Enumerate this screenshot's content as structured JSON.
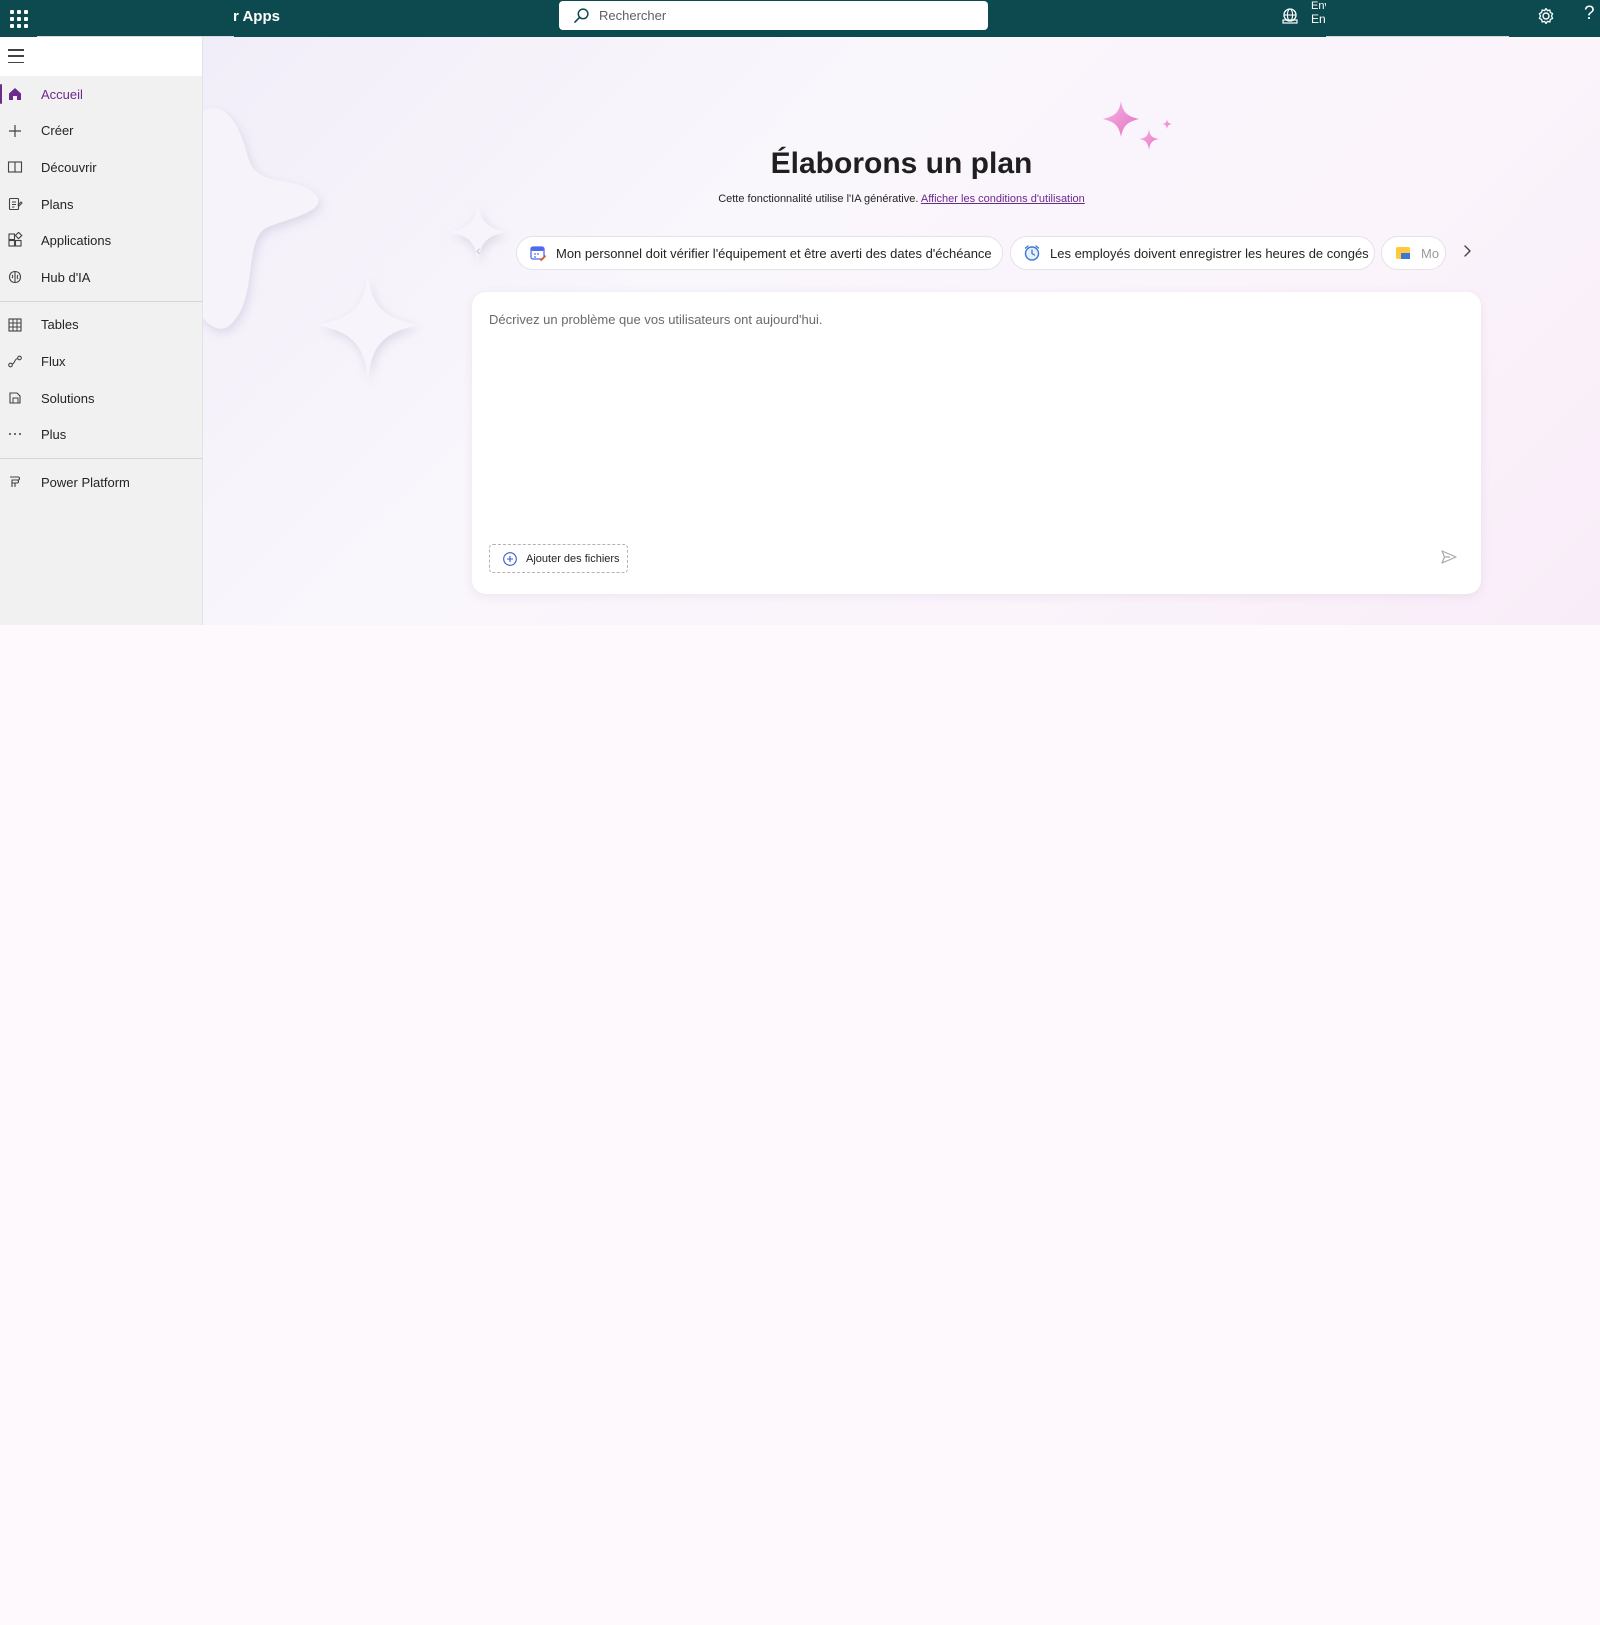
{
  "topbar": {
    "app_name": "r Apps",
    "search_placeholder": "Rechercher",
    "environment_line1": "Env",
    "environment_line2": "En",
    "help_label": "?"
  },
  "sidebar": {
    "items": [
      {
        "label": "Accueil",
        "icon": "home-icon",
        "active": true
      },
      {
        "label": "Créer",
        "icon": "plus-icon"
      },
      {
        "label": "Découvrir",
        "icon": "book-icon"
      },
      {
        "label": "Plans",
        "icon": "plans-icon"
      },
      {
        "label": "Applications",
        "icon": "apps-icon"
      },
      {
        "label": "Hub d'IA",
        "icon": "brain-icon"
      },
      {
        "label": "Tables",
        "icon": "table-icon"
      },
      {
        "label": "Flux",
        "icon": "flow-icon"
      },
      {
        "label": "Solutions",
        "icon": "solutions-icon"
      },
      {
        "label": "Plus",
        "icon": "more-icon"
      },
      {
        "label": "Power Platform",
        "icon": "power-platform-icon"
      }
    ]
  },
  "main": {
    "title": "Élaborons un plan",
    "subtitle": "Cette fonctionnalité utilise l'IA générative.",
    "terms_link": "Afficher les conditions d'utilisation",
    "suggestions": [
      {
        "label": "Mon personnel doit vérifier l'équipement et être averti des dates d'échéance",
        "icon": "calendar-icon"
      },
      {
        "label": "Les employés doivent enregistrer les heures de congés",
        "icon": "clock-icon"
      },
      {
        "label": "Mo",
        "icon": "folder-icon"
      }
    ],
    "prompt_placeholder": "Décrivez un problème que vos utilisateurs ont aujourd'hui.",
    "add_files_label": "Ajouter des fichiers"
  },
  "colors": {
    "topbar": "#0c4a4f",
    "accent": "#6b2a8c",
    "sparkle": "#e56fc4"
  }
}
